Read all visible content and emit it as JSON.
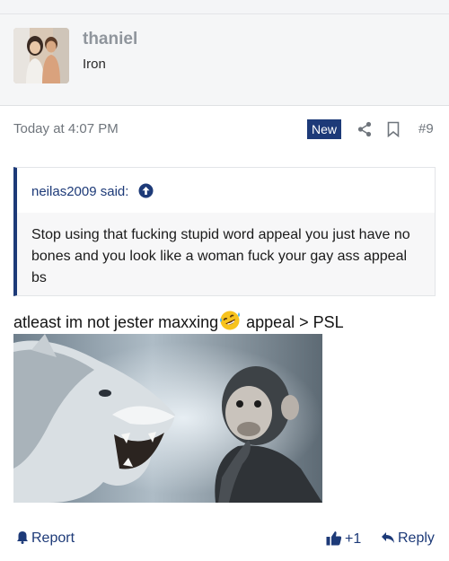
{
  "post": {
    "author": {
      "username": "thaniel",
      "title": "Iron",
      "avatar_icon": "user-avatar-photo"
    },
    "meta": {
      "date": "Today at 4:07 PM",
      "badge": "New",
      "number": "#9"
    },
    "quote": {
      "author_line": "neilas2009 said:",
      "text": "Stop using that fucking stupid word appeal you just have no bones and you look like a woman fuck your gay ass appeal bs"
    },
    "body": {
      "text_before_emoji": "atleast im not jester maxxing",
      "emoji": "rolling-on-floor-laughing-emoji",
      "text_after_emoji": " appeal > PSL",
      "image_icon": "lion-vs-monkey-image"
    },
    "actions": {
      "report": "Report",
      "likes": "+1",
      "reply": "Reply"
    }
  },
  "colors": {
    "accent": "#1d3a78",
    "username": "#8f959c",
    "muted": "#6f757c"
  }
}
